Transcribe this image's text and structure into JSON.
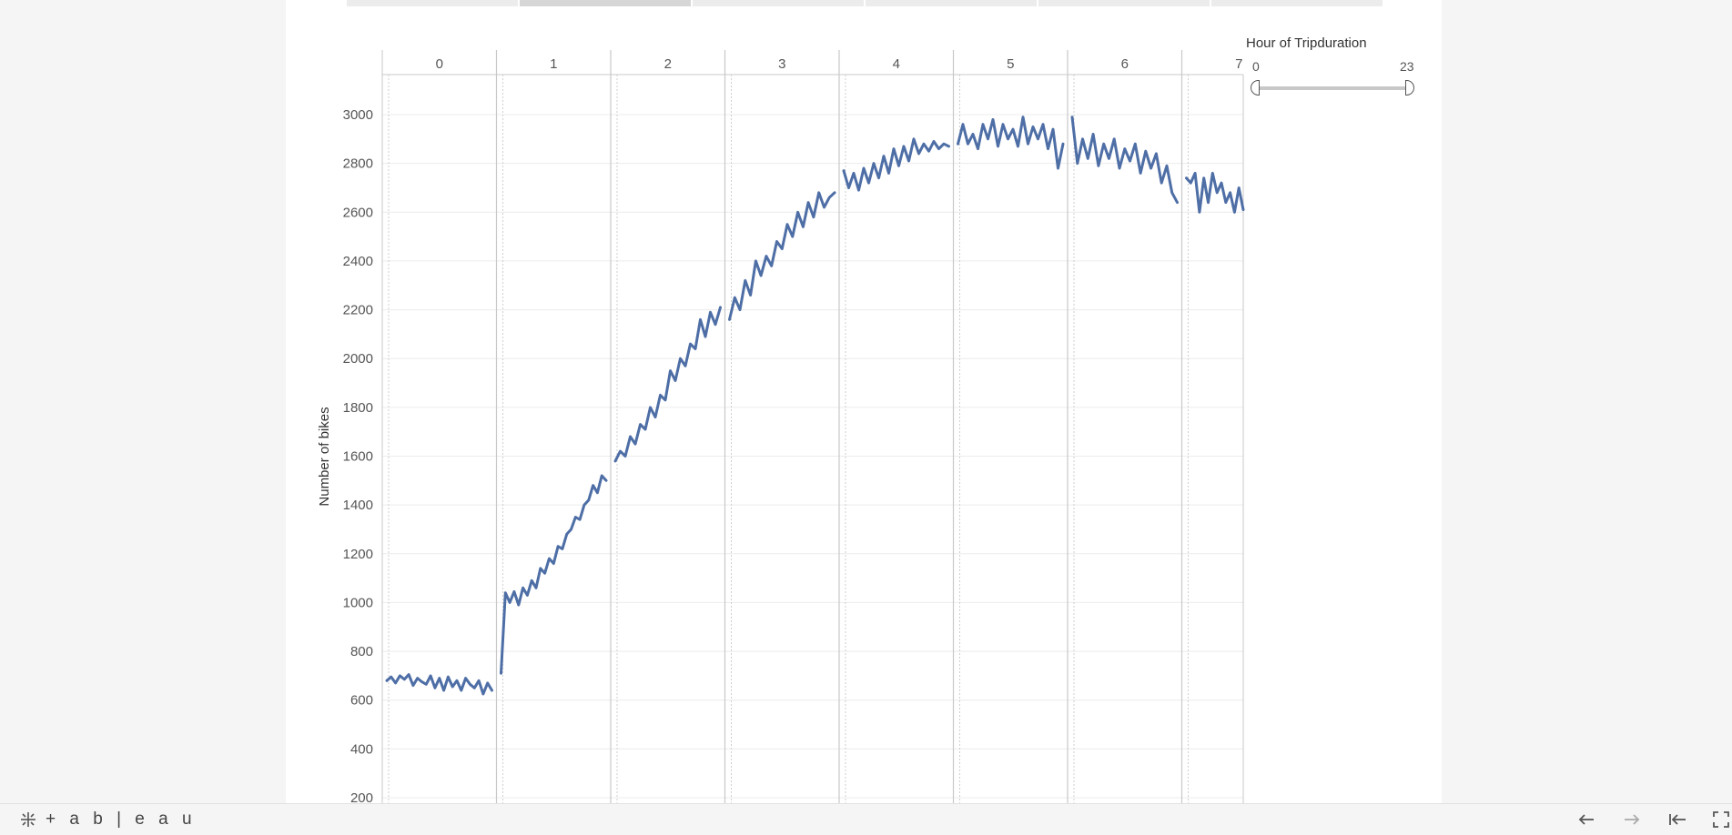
{
  "story_tabs": [
    {
      "active": false
    },
    {
      "active": true
    },
    {
      "active": false
    },
    {
      "active": false
    },
    {
      "active": false
    },
    {
      "active": false
    }
  ],
  "filter": {
    "title": "Hour of Tripduration",
    "min_label": "0",
    "max_label": "23",
    "range": [
      0,
      23
    ]
  },
  "toolbar": {
    "logo_text": "+ a b | e a u",
    "icons": [
      "tableau-logo-icon",
      "back-arrow-icon",
      "forward-arrow-icon",
      "first-page-icon",
      "fullscreen-icon"
    ]
  },
  "colors": {
    "line": "#4e6ea6",
    "grid": "#ececec",
    "divider": "#c8c8c8",
    "dashboard_bg": "#ffffff",
    "page_bg": "#f5f5f5"
  },
  "chart_data": {
    "type": "line",
    "xlabel": "",
    "ylabel": "Number of bikes",
    "ylim": [
      120,
      3180
    ],
    "yticks": [
      200,
      400,
      600,
      800,
      1000,
      1200,
      1400,
      1600,
      1800,
      2000,
      2200,
      2400,
      2600,
      2800,
      3000
    ],
    "grid": true,
    "panels": [
      {
        "label": "0",
        "values": [
          680,
          695,
          670,
          700,
          685,
          705,
          660,
          690,
          675,
          665,
          700,
          650,
          690,
          640,
          695,
          655,
          680,
          640,
          690,
          665,
          650,
          680,
          625,
          670,
          640
        ]
      },
      {
        "label": "1",
        "values": [
          710,
          1040,
          1000,
          1045,
          990,
          1060,
          1030,
          1090,
          1060,
          1140,
          1120,
          1180,
          1160,
          1230,
          1220,
          1280,
          1300,
          1350,
          1340,
          1400,
          1420,
          1480,
          1450,
          1520,
          1500
        ]
      },
      {
        "label": "2",
        "values": [
          1580,
          1620,
          1600,
          1680,
          1650,
          1730,
          1710,
          1800,
          1760,
          1850,
          1830,
          1950,
          1910,
          2000,
          1970,
          2060,
          2040,
          2160,
          2090,
          2190,
          2140,
          2210
        ]
      },
      {
        "label": "3",
        "values": [
          2160,
          2250,
          2200,
          2320,
          2260,
          2400,
          2340,
          2420,
          2380,
          2480,
          2450,
          2550,
          2500,
          2600,
          2540,
          2640,
          2580,
          2680,
          2620,
          2660,
          2680
        ]
      },
      {
        "label": "4",
        "values": [
          2770,
          2700,
          2760,
          2690,
          2780,
          2720,
          2800,
          2740,
          2830,
          2760,
          2860,
          2790,
          2870,
          2810,
          2900,
          2840,
          2880,
          2850,
          2890,
          2860,
          2880,
          2870
        ]
      },
      {
        "label": "5",
        "values": [
          2880,
          2960,
          2880,
          2920,
          2860,
          2960,
          2900,
          2980,
          2870,
          2960,
          2900,
          2940,
          2870,
          2990,
          2880,
          2950,
          2900,
          2960,
          2860,
          2940,
          2780,
          2880
        ]
      },
      {
        "label": "6",
        "values": [
          2990,
          2800,
          2900,
          2820,
          2920,
          2790,
          2880,
          2820,
          2900,
          2780,
          2860,
          2810,
          2880,
          2760,
          2850,
          2780,
          2840,
          2720,
          2790,
          2680,
          2640
        ]
      },
      {
        "label": "7",
        "values": [
          2740,
          2720,
          2760,
          2600,
          2740,
          2640,
          2760,
          2680,
          2720,
          2640,
          2680,
          2600,
          2700,
          2610
        ]
      }
    ]
  }
}
